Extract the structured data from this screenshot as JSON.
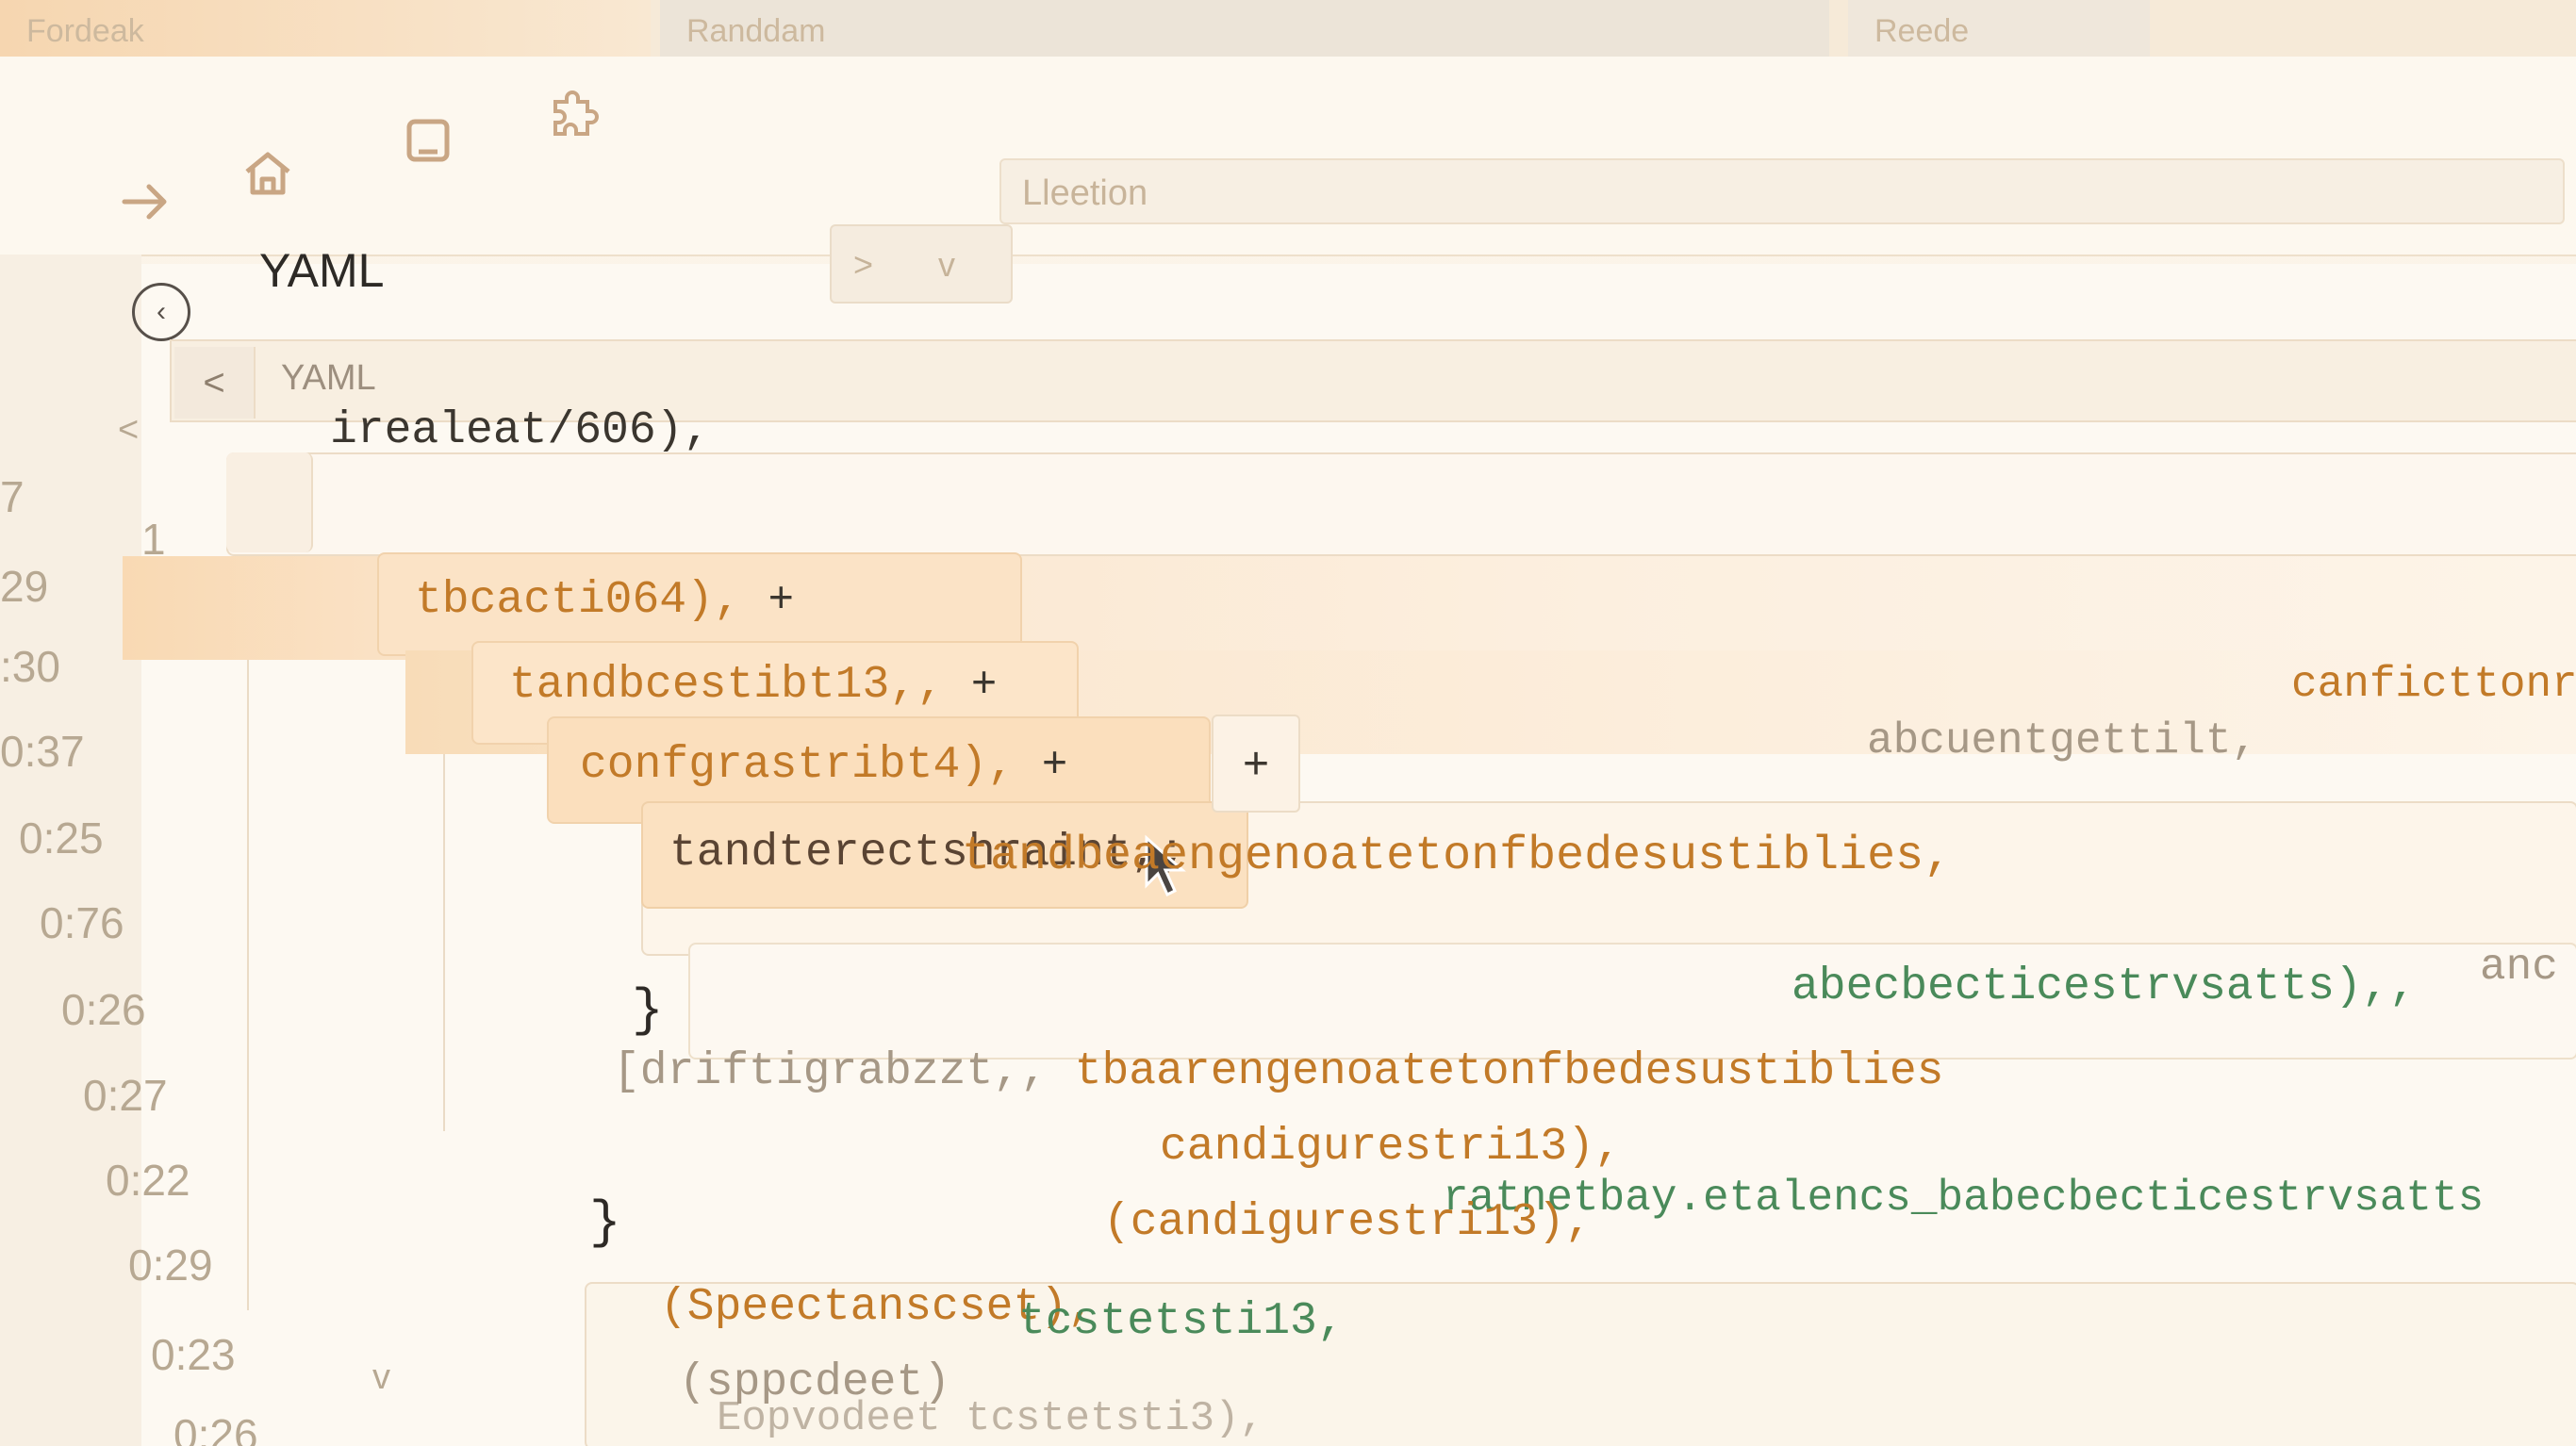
{
  "tabs": [
    "Fordeak",
    "Randdam",
    "Reede"
  ],
  "toolbar": {
    "icons": [
      "back-arrow-icon",
      "forward-arrow-icon",
      "home-icon",
      "window-icon",
      "extension-icon"
    ],
    "address_text": "Lleetion"
  },
  "header": {
    "title": "YAML",
    "dropdown_items": [
      ">",
      "v"
    ]
  },
  "subheader": {
    "back": "<",
    "label": "YAML"
  },
  "gutter": {
    "line_numbers": [
      "7",
      "1",
      "29",
      ":30",
      "0:37",
      "0:25",
      "0:76",
      "0:26",
      "0:27",
      "0:22",
      "0:29",
      "0:23",
      "0:26"
    ],
    "chevrons": [
      "<",
      "v"
    ]
  },
  "code": {
    "line1": "irealeat/606),",
    "line2_text": "tbcacti064),",
    "line2_plus": "+",
    "line3_text": "tandbcestibt13,,",
    "line3_plus": "+",
    "line4_text": "confgrastribt4),",
    "line4_plus": "+",
    "line5_text": "tandterectshraint,;",
    "line5_plus": "+",
    "line5_tail": "abcuentgettilt,",
    "line5_tail2": "canficttonr",
    "line6_text": "tandbeaengenoatetonfbedesustiblies,",
    "close1": "}",
    "line7_gray": "[driftigrabzzt,,",
    "line7_orange": "tbaarengenoatetonfbedesustiblies",
    "line7_green": "abecbecticestrvsatts),,",
    "line7_tail": "anc",
    "line8_text": "candigurestri13),",
    "line8_green": "ratnetbay.etalencs_babecbecticestrvsatts",
    "close2": "}",
    "line9_a": "(Speectanscset),",
    "line9_b": "(candigurestri13),",
    "line10_a": "(sppcdeet)",
    "line10_b": "tcstetsti13,",
    "line11": "Eopvodeet tcstetsti3),"
  }
}
